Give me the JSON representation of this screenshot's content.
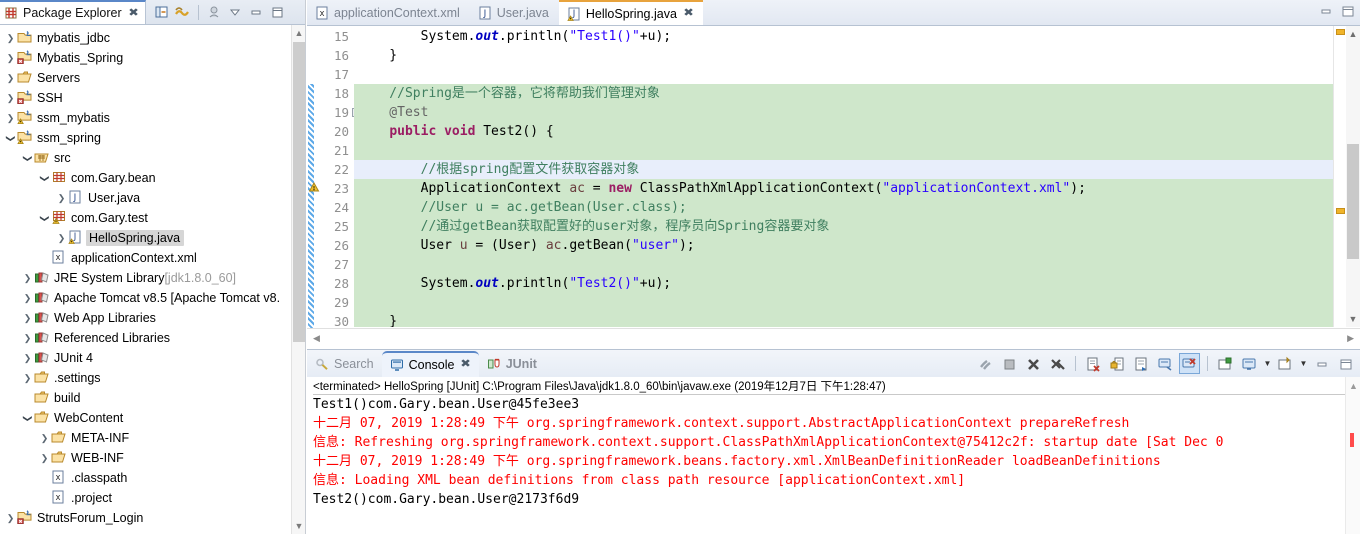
{
  "explorer": {
    "tab_label": "Package Explorer",
    "close_icon": "close-icon",
    "toolbar": [
      {
        "name": "collapse-all-icon",
        "label": "Collapse All"
      },
      {
        "name": "link-with-editor-icon",
        "label": "Link with Editor"
      },
      {
        "name": "focus-on-active-task-icon",
        "label": "Focus on Active Task"
      },
      {
        "name": "view-menu-icon",
        "label": "View Menu"
      },
      {
        "name": "minimize-icon",
        "label": "Minimize"
      },
      {
        "name": "maximize-icon",
        "label": "Maximize"
      }
    ],
    "tree": [
      {
        "label": "mybatis_jdbc",
        "indent": 0,
        "arrow": "collapsed",
        "icon": "java-project-icon",
        "selected": false
      },
      {
        "label": "Mybatis_Spring",
        "indent": 0,
        "arrow": "collapsed",
        "icon": "java-project-error-icon",
        "selected": false
      },
      {
        "label": "Servers",
        "indent": 0,
        "arrow": "collapsed",
        "icon": "folder-icon",
        "selected": false
      },
      {
        "label": "SSH",
        "indent": 0,
        "arrow": "collapsed",
        "icon": "java-project-error-icon",
        "selected": false
      },
      {
        "label": "ssm_mybatis",
        "indent": 0,
        "arrow": "collapsed",
        "icon": "java-project-warning-icon",
        "selected": false
      },
      {
        "label": "ssm_spring",
        "indent": 0,
        "arrow": "expanded",
        "icon": "java-project-warning-icon",
        "selected": false
      },
      {
        "label": "src",
        "indent": 1,
        "arrow": "expanded",
        "icon": "source-folder-icon",
        "selected": false
      },
      {
        "label": "com.Gary.bean",
        "indent": 2,
        "arrow": "expanded",
        "icon": "package-icon",
        "selected": false
      },
      {
        "label": "User.java",
        "indent": 3,
        "arrow": "collapsed",
        "icon": "java-file-icon",
        "selected": false
      },
      {
        "label": "com.Gary.test",
        "indent": 2,
        "arrow": "expanded",
        "icon": "package-warning-icon",
        "selected": false
      },
      {
        "label": "HelloSpring.java",
        "indent": 3,
        "arrow": "collapsed",
        "icon": "java-file-warning-icon",
        "selected": true
      },
      {
        "label": "applicationContext.xml",
        "indent": 2,
        "arrow": "none",
        "icon": "xml-file-icon",
        "selected": false
      },
      {
        "label": "JRE System Library",
        "suffix": "[jdk1.8.0_60]",
        "indent": 1,
        "arrow": "collapsed",
        "icon": "library-icon",
        "selected": false
      },
      {
        "label": "Apache Tomcat v8.5 [Apache Tomcat v8.",
        "indent": 1,
        "arrow": "collapsed",
        "icon": "library-icon",
        "selected": false
      },
      {
        "label": "Web App Libraries",
        "indent": 1,
        "arrow": "collapsed",
        "icon": "library-icon",
        "selected": false
      },
      {
        "label": "Referenced Libraries",
        "indent": 1,
        "arrow": "collapsed",
        "icon": "library-icon",
        "selected": false
      },
      {
        "label": "JUnit 4",
        "indent": 1,
        "arrow": "collapsed",
        "icon": "library-icon",
        "selected": false
      },
      {
        "label": ".settings",
        "indent": 1,
        "arrow": "collapsed",
        "icon": "folder-icon",
        "selected": false
      },
      {
        "label": "build",
        "indent": 1,
        "arrow": "none",
        "icon": "folder-icon",
        "selected": false
      },
      {
        "label": "WebContent",
        "indent": 1,
        "arrow": "expanded",
        "icon": "folder-icon",
        "selected": false
      },
      {
        "label": "META-INF",
        "indent": 2,
        "arrow": "collapsed",
        "icon": "folder-icon",
        "selected": false
      },
      {
        "label": "WEB-INF",
        "indent": 2,
        "arrow": "collapsed",
        "icon": "folder-icon",
        "selected": false
      },
      {
        "label": ".classpath",
        "indent": 2,
        "arrow": "none",
        "icon": "xml-file-icon",
        "selected": false
      },
      {
        "label": ".project",
        "indent": 2,
        "arrow": "none",
        "icon": "xml-file-icon",
        "selected": false
      },
      {
        "label": "StrutsForum_Login",
        "indent": 0,
        "arrow": "collapsed",
        "icon": "java-project-error-icon",
        "selected": false
      }
    ]
  },
  "editor": {
    "tabs": [
      {
        "label": "applicationContext.xml",
        "icon": "xml-file-icon",
        "active": false,
        "closable": false
      },
      {
        "label": "User.java",
        "icon": "java-file-icon",
        "active": false,
        "closable": false
      },
      {
        "label": "HelloSpring.java",
        "icon": "java-file-warning-icon",
        "active": true,
        "closable": true
      }
    ],
    "window_controls": [
      {
        "name": "minimize-icon",
        "label": "Minimize"
      },
      {
        "name": "maximize-icon",
        "label": "Maximize"
      }
    ],
    "first_line_number": 15,
    "lines": [
      {
        "n": 15,
        "hl": false,
        "cur": false,
        "fold": false,
        "warn": false,
        "tokens": [
          {
            "t": "        System.",
            "c": "plain"
          },
          {
            "t": "out",
            "c": "sfield"
          },
          {
            "t": ".println(",
            "c": "plain"
          },
          {
            "t": "\"Test1()\"",
            "c": "str"
          },
          {
            "t": "+u);",
            "c": "plain"
          }
        ]
      },
      {
        "n": 16,
        "hl": false,
        "cur": false,
        "fold": false,
        "warn": false,
        "tokens": [
          {
            "t": "    }",
            "c": "plain"
          }
        ]
      },
      {
        "n": 17,
        "hl": false,
        "cur": false,
        "fold": false,
        "warn": false,
        "tokens": []
      },
      {
        "n": 18,
        "hl": true,
        "cur": false,
        "fold": false,
        "warn": false,
        "tokens": [
          {
            "t": "    //Spring是一个容器，它将帮助我们管理对象",
            "c": "cmt"
          }
        ]
      },
      {
        "n": 19,
        "hl": true,
        "cur": false,
        "fold": true,
        "warn": false,
        "tokens": [
          {
            "t": "    @Test",
            "c": "ann"
          }
        ]
      },
      {
        "n": 20,
        "hl": true,
        "cur": false,
        "fold": false,
        "warn": false,
        "tokens": [
          {
            "t": "    ",
            "c": "plain"
          },
          {
            "t": "public void",
            "c": "kw"
          },
          {
            "t": " Test2() {",
            "c": "plain"
          }
        ]
      },
      {
        "n": 21,
        "hl": true,
        "cur": false,
        "fold": false,
        "warn": false,
        "tokens": []
      },
      {
        "n": 22,
        "hl": true,
        "cur": true,
        "fold": false,
        "warn": false,
        "tokens": [
          {
            "t": "        //根据spring配置文件获取容器对象",
            "c": "cmt"
          }
        ]
      },
      {
        "n": 23,
        "hl": true,
        "cur": false,
        "fold": false,
        "warn": true,
        "tokens": [
          {
            "t": "        ApplicationContext ",
            "c": "plain"
          },
          {
            "t": "ac",
            "c": "lvar"
          },
          {
            "t": " = ",
            "c": "plain"
          },
          {
            "t": "new",
            "c": "kw"
          },
          {
            "t": " ClassPathXmlApplicationContext(",
            "c": "plain"
          },
          {
            "t": "\"applicationContext.xml\"",
            "c": "str"
          },
          {
            "t": ");",
            "c": "plain"
          }
        ]
      },
      {
        "n": 24,
        "hl": true,
        "cur": false,
        "fold": false,
        "warn": false,
        "tokens": [
          {
            "t": "        //User u = ac.getBean(User.class);",
            "c": "cmt"
          }
        ]
      },
      {
        "n": 25,
        "hl": true,
        "cur": false,
        "fold": false,
        "warn": false,
        "tokens": [
          {
            "t": "        //通过getBean获取配置好的user对象，程序员向Spring容器要对象",
            "c": "cmt"
          }
        ]
      },
      {
        "n": 26,
        "hl": true,
        "cur": false,
        "fold": false,
        "warn": false,
        "tokens": [
          {
            "t": "        User ",
            "c": "plain"
          },
          {
            "t": "u",
            "c": "lvar"
          },
          {
            "t": " = (User) ",
            "c": "plain"
          },
          {
            "t": "ac",
            "c": "lvar"
          },
          {
            "t": ".getBean(",
            "c": "plain"
          },
          {
            "t": "\"user\"",
            "c": "str"
          },
          {
            "t": ");",
            "c": "plain"
          }
        ]
      },
      {
        "n": 27,
        "hl": true,
        "cur": false,
        "fold": false,
        "warn": false,
        "tokens": []
      },
      {
        "n": 28,
        "hl": true,
        "cur": false,
        "fold": false,
        "warn": false,
        "tokens": [
          {
            "t": "        System.",
            "c": "plain"
          },
          {
            "t": "out",
            "c": "sfield"
          },
          {
            "t": ".println(",
            "c": "plain"
          },
          {
            "t": "\"Test2()\"",
            "c": "str"
          },
          {
            "t": "+u);",
            "c": "plain"
          }
        ]
      },
      {
        "n": 29,
        "hl": true,
        "cur": false,
        "fold": false,
        "warn": false,
        "tokens": []
      },
      {
        "n": 30,
        "hl": true,
        "cur": false,
        "fold": false,
        "warn": false,
        "tokens": [
          {
            "t": "    }",
            "c": "plain"
          }
        ]
      }
    ]
  },
  "console": {
    "tabs": [
      {
        "label": "Search",
        "icon": "search-icon",
        "active": false,
        "closable": false
      },
      {
        "label": "Console",
        "icon": "console-icon",
        "active": true,
        "closable": true
      },
      {
        "label": "JUnit",
        "icon": "junit-icon",
        "active": false,
        "closable": false
      }
    ],
    "toolbar": [
      {
        "name": "terminate-all-icon",
        "label": "Terminate/Disconnect All"
      },
      {
        "name": "terminate-icon",
        "label": "Terminate"
      },
      {
        "name": "remove-launch-icon",
        "label": "Remove Launch"
      },
      {
        "name": "remove-all-terminated-icon",
        "label": "Remove All Terminated Launches"
      },
      {
        "name": "clear-console-icon",
        "label": "Clear Console"
      },
      {
        "name": "scroll-lock-icon",
        "label": "Scroll Lock"
      },
      {
        "name": "word-wrap-icon",
        "label": "Word Wrap"
      },
      {
        "name": "show-console-on-output-icon",
        "label": "Show Console When Standard Out Changes"
      },
      {
        "name": "show-console-on-error-icon",
        "label": "Show Console When Standard Error Changes",
        "pressed": true
      },
      {
        "name": "pin-console-icon",
        "label": "Pin Console"
      },
      {
        "name": "display-selected-console-icon",
        "label": "Display Selected Console"
      },
      {
        "name": "display-selected-console-dropdown-icon",
        "label": "Display Selected Console Menu"
      },
      {
        "name": "open-console-icon",
        "label": "Open Console"
      },
      {
        "name": "open-console-dropdown-icon",
        "label": "Open Console Menu"
      },
      {
        "name": "minimize-icon",
        "label": "Minimize"
      },
      {
        "name": "maximize-icon",
        "label": "Maximize"
      }
    ],
    "header": "<terminated> HelloSpring [JUnit] C:\\Program Files\\Java\\jdk1.8.0_60\\bin\\javaw.exe (2019年12月7日 下午1:28:47)",
    "output": [
      {
        "text": "Test1()com.Gary.bean.User@45fe3ee3",
        "stream": "out"
      },
      {
        "text": "十二月 07, 2019 1:28:49 下午 org.springframework.context.support.AbstractApplicationContext prepareRefresh",
        "stream": "err"
      },
      {
        "text": "信息: Refreshing org.springframework.context.support.ClassPathXmlApplicationContext@75412c2f: startup date [Sat Dec 0",
        "stream": "err"
      },
      {
        "text": "十二月 07, 2019 1:28:49 下午 org.springframework.beans.factory.xml.XmlBeanDefinitionReader loadBeanDefinitions",
        "stream": "err"
      },
      {
        "text": "信息: Loading XML bean definitions from class path resource [applicationContext.xml]",
        "stream": "err"
      },
      {
        "text": "Test2()com.Gary.bean.User@2173f6d9",
        "stream": "out"
      }
    ]
  },
  "colors": {
    "accent_blue": "#5a87c8",
    "active_tab_orange": "#e8a33d",
    "code_highlight_green": "#cfe7cb",
    "current_line_blue": "#e8eefb",
    "error_red": "#ff0000",
    "string_blue": "#2a00ff",
    "comment_green": "#3f7f5f",
    "keyword_magenta": "#9b1d63"
  }
}
